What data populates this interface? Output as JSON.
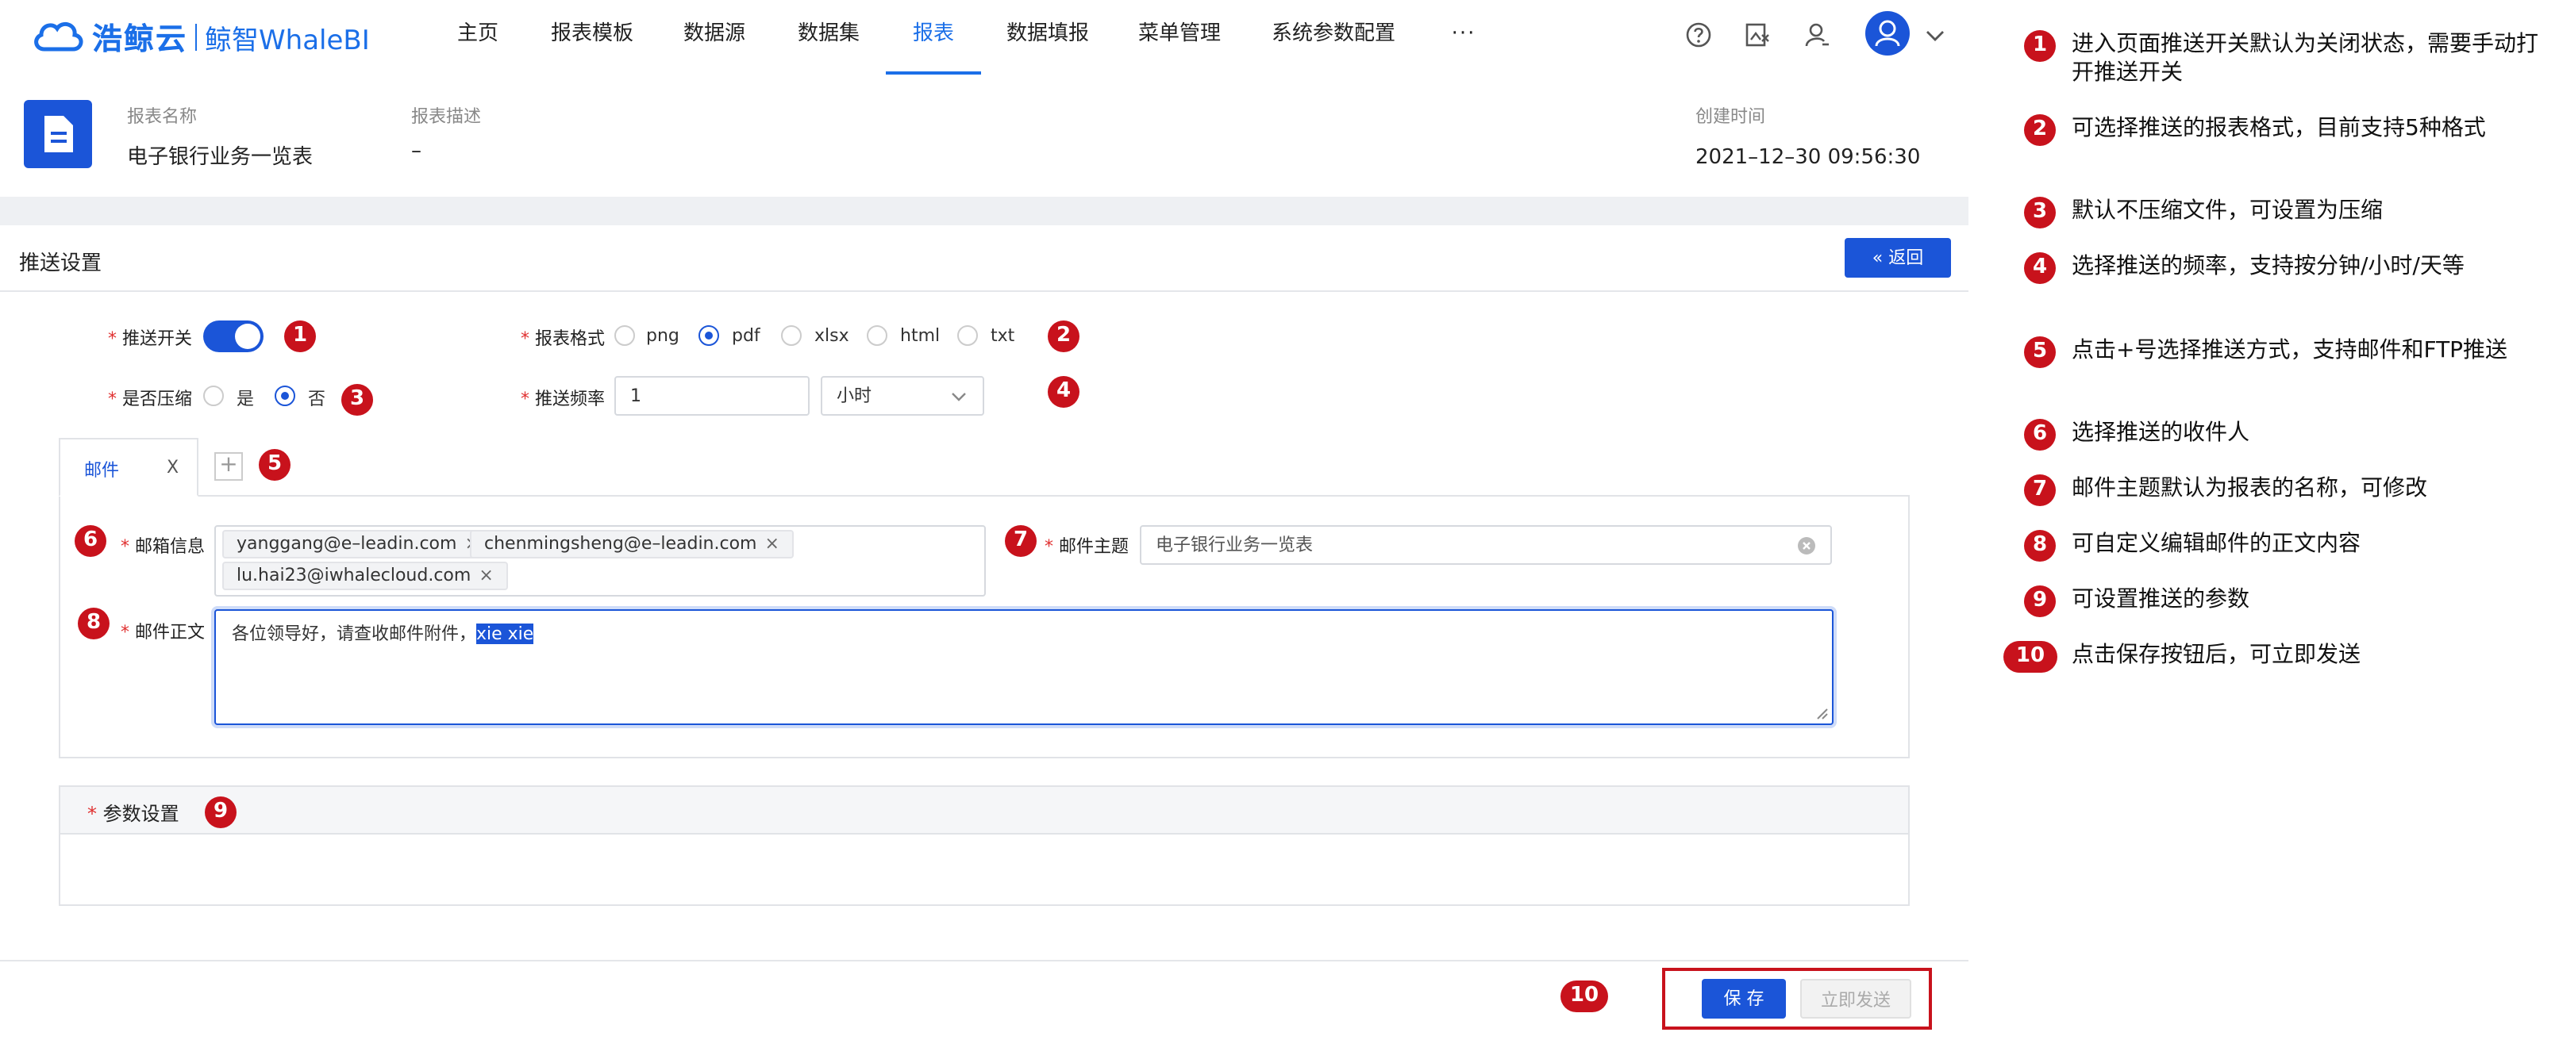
{
  "header": {
    "logo_brand": "浩鲸云",
    "logo_sub": "鲸智WhaleBI",
    "nav": [
      "主页",
      "报表模板",
      "数据源",
      "数据集",
      "报表",
      "数据填报",
      "菜单管理",
      "系统参数配置",
      "···"
    ],
    "active_nav": "报表"
  },
  "report_info": {
    "name_label": "报表名称",
    "name_value": "电子银行业务一览表",
    "desc_label": "报表描述",
    "desc_value": "–",
    "created_label": "创建时间",
    "created_value": "2021–12–30 09:56:30"
  },
  "section": {
    "title": "推送设置",
    "back_label": "返回"
  },
  "form": {
    "push_switch_label": "推送开关",
    "push_switch_on": true,
    "format_label": "报表格式",
    "format_options": [
      "png",
      "pdf",
      "xlsx",
      "html",
      "txt"
    ],
    "format_selected": "pdf",
    "compress_label": "是否压缩",
    "compress_options": [
      "是",
      "否"
    ],
    "compress_selected": "否",
    "freq_label": "推送频率",
    "freq_value": "1",
    "freq_unit": "小时"
  },
  "tabs": {
    "items": [
      {
        "label": "邮件",
        "close": "X"
      }
    ],
    "add_label": "+"
  },
  "mail": {
    "recipients_label": "邮箱信息",
    "recipients": [
      "yanggang@e–leadin.com",
      "chenmingsheng@e–leadin.com",
      "lu.hai23@iwhalecloud.com"
    ],
    "subject_label": "邮件主题",
    "subject_value": "电子银行业务一览表",
    "body_label": "邮件正文",
    "body_text": "各位领导好，请查收邮件附件，",
    "body_selected": "xie xie"
  },
  "params": {
    "title": "参数设置"
  },
  "footer": {
    "save_label": "保 存",
    "send_label": "立即发送"
  },
  "badges": [
    "1",
    "2",
    "3",
    "4",
    "5",
    "6",
    "7",
    "8",
    "9",
    "10"
  ],
  "notes": [
    {
      "num": "1",
      "text": "进入页面推送开关默认为关闭状态，需要手动打开推送开关"
    },
    {
      "num": "2",
      "text": "可选择推送的报表格式，目前支持5种格式"
    },
    {
      "num": "3",
      "text": "默认不压缩文件，可设置为压缩"
    },
    {
      "num": "4",
      "text": "选择推送的频率，支持按分钟/小时/天等"
    },
    {
      "num": "5",
      "text": "点击+号选择推送方式，支持邮件和FTP推送"
    },
    {
      "num": "6",
      "text": "选择推送的收件人"
    },
    {
      "num": "7",
      "text": "邮件主题默认为报表的名称，可修改"
    },
    {
      "num": "8",
      "text": "可自定义编辑邮件的正文内容"
    },
    {
      "num": "9",
      "text": "可设置推送的参数"
    },
    {
      "num": "10",
      "text": "点击保存按钮后，可立即发送"
    }
  ],
  "colors": {
    "primary": "#1b55d8",
    "badge": "#c8121c",
    "highlight_box": "#c8121c"
  }
}
